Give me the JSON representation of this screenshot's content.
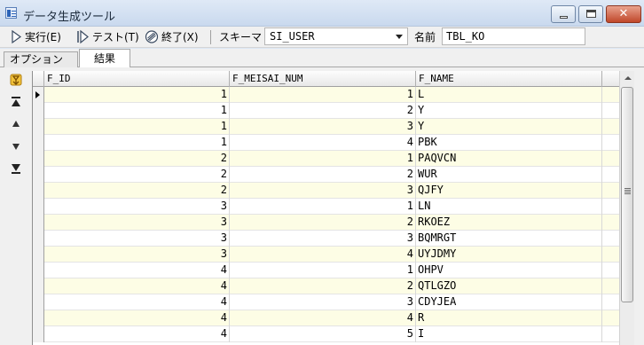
{
  "window": {
    "title": "データ生成ツール",
    "icons": {
      "app": "app-icon",
      "minimize": "minimize-icon",
      "maximize": "maximize-icon",
      "close": "close-icon"
    }
  },
  "toolbar": {
    "run_label": "実行(E)",
    "test_label": "テスト(T)",
    "exit_label": "終了(X)",
    "schema_label": "スキーマ",
    "schema_value": "SI_USER",
    "name_label": "名前",
    "name_value": "TBL_KO"
  },
  "tabs": [
    {
      "label": "オプション",
      "active": false
    },
    {
      "label": "結果",
      "active": true
    }
  ],
  "sidebar": {
    "icons": [
      "clear-icon",
      "move-top-icon",
      "move-up-icon",
      "move-down-icon",
      "move-bottom-icon"
    ]
  },
  "grid": {
    "columns": [
      "F_ID",
      "F_MEISAI_NUM",
      "F_NAME"
    ],
    "rows": [
      [
        "1",
        "1",
        "L"
      ],
      [
        "1",
        "2",
        "Y"
      ],
      [
        "1",
        "3",
        "Y"
      ],
      [
        "1",
        "4",
        "PBK"
      ],
      [
        "2",
        "1",
        "PAQVCN"
      ],
      [
        "2",
        "2",
        "WUR"
      ],
      [
        "2",
        "3",
        "QJFY"
      ],
      [
        "3",
        "1",
        "LN"
      ],
      [
        "3",
        "2",
        "RKOEZ"
      ],
      [
        "3",
        "3",
        "BQMRGT"
      ],
      [
        "3",
        "4",
        "UYJDMY"
      ],
      [
        "4",
        "1",
        "OHPV"
      ],
      [
        "4",
        "2",
        "QTLGZO"
      ],
      [
        "4",
        "3",
        "CDYJEA"
      ],
      [
        "4",
        "4",
        "R"
      ],
      [
        "4",
        "5",
        "I"
      ]
    ],
    "selected_row": 0
  },
  "colors": {
    "alt_row": "#fdfde5",
    "title_bar": "#dfe9f6",
    "close_button": "#c0472a"
  }
}
